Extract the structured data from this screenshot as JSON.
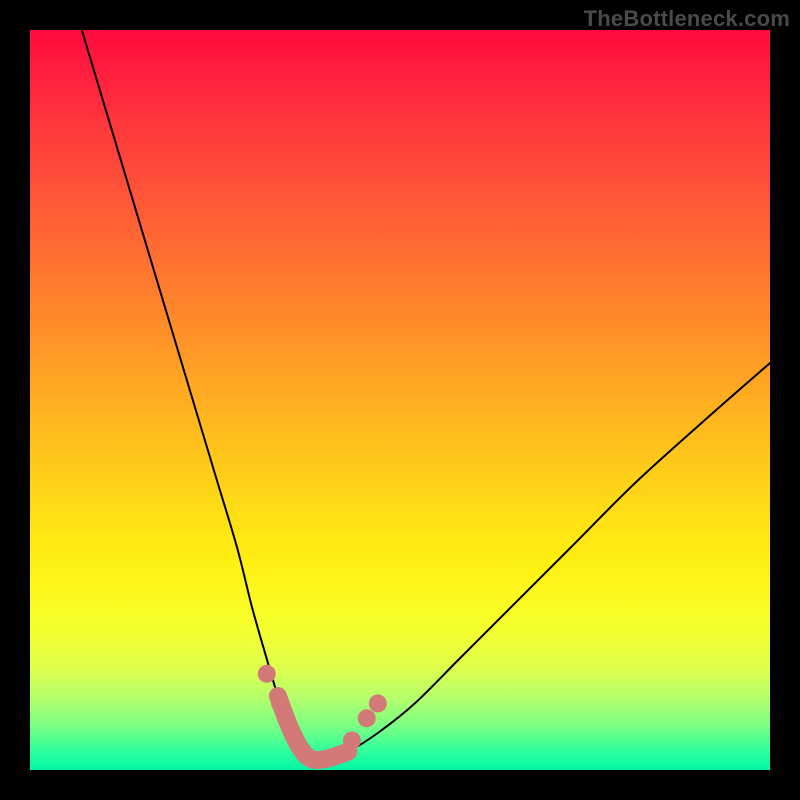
{
  "brand": {
    "watermark": "TheBottleneck.com"
  },
  "colors": {
    "marker": "#d37a78",
    "curve": "#000000",
    "background_top": "#ff0a3c",
    "background_bottom": "#00f7a6"
  },
  "chart_data": {
    "type": "line",
    "title": "",
    "xlabel": "",
    "ylabel": "",
    "xlim": [
      0,
      100
    ],
    "ylim": [
      0,
      100
    ],
    "grid": false,
    "legend": false,
    "series": [
      {
        "name": "bottleneck-curve",
        "x": [
          7,
          10,
          13,
          16,
          19,
          22,
          25,
          28,
          30,
          32,
          33.5,
          35,
          36.5,
          38,
          40,
          43,
          47,
          52,
          58,
          65,
          73,
          82,
          92,
          100
        ],
        "y": [
          100,
          90,
          80,
          70,
          60,
          50,
          40,
          30,
          22,
          15,
          10,
          6,
          3,
          1.5,
          1.5,
          2.5,
          5,
          9,
          15,
          22,
          30,
          39,
          48,
          55
        ]
      }
    ],
    "markers": {
      "valley_segment": {
        "x": [
          33.5,
          35,
          36.5,
          38,
          40,
          43
        ],
        "y": [
          10,
          6,
          3,
          1.5,
          1.5,
          2.5
        ]
      },
      "dots": [
        {
          "x": 32,
          "y": 13
        },
        {
          "x": 33.8,
          "y": 9
        },
        {
          "x": 43.5,
          "y": 4
        },
        {
          "x": 45.5,
          "y": 7
        },
        {
          "x": 47,
          "y": 9
        }
      ]
    }
  }
}
